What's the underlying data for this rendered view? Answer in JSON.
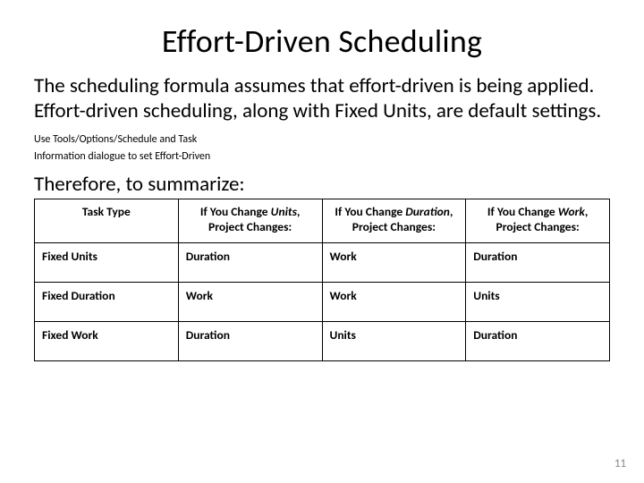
{
  "title": "Effort-Driven Scheduling",
  "paragraph": {
    "main": "The scheduling formula assumes that effort-driven is being applied. Effort-driven scheduling, along with Fixed Units, are default settings. ",
    "hint1": "Use Tools/Options/Schedule  and Task",
    "hint2": "Information dialogue  to set  Effort-Driven"
  },
  "summary_line": "Therefore, to summarize:",
  "table": {
    "headers": {
      "c0": "Task Type",
      "c1_pre": "If You Change ",
      "c1_em": "Units",
      "c1_post": ", Project Changes:",
      "c2_pre": "If You Change ",
      "c2_em": "Duration",
      "c2_post": ", Project Changes:",
      "c3_pre": "If You Change ",
      "c3_em": "Work",
      "c3_post": ", Project Changes:"
    },
    "rows": [
      {
        "label": "Fixed Units",
        "c1": "Duration",
        "c2": "Work",
        "c3": "Duration"
      },
      {
        "label": "Fixed Duration",
        "c1": "Work",
        "c2": "Work",
        "c3": "Units"
      },
      {
        "label": "Fixed Work",
        "c1": "Duration",
        "c2": "Units",
        "c3": "Duration"
      }
    ]
  },
  "page_number": "11"
}
